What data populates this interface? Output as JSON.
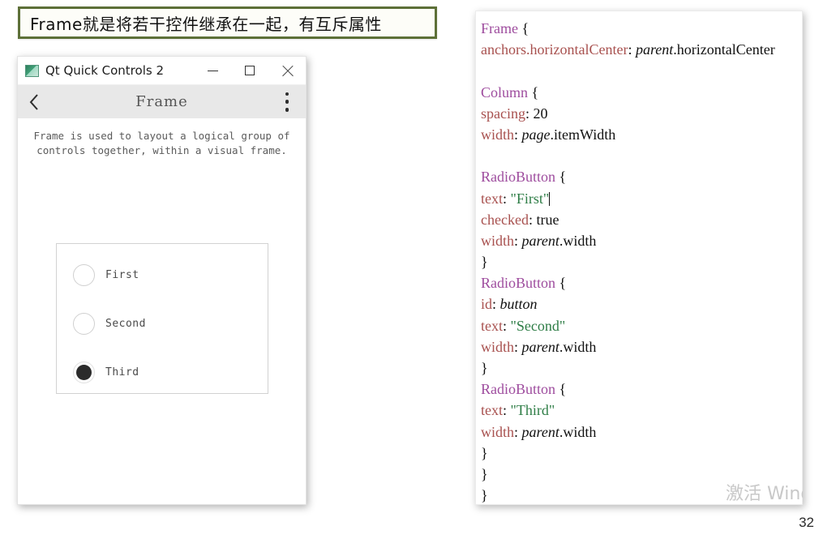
{
  "caption": {
    "text": "Frame就是将若干控件继承在一起，有互斥属性",
    "border_color": "#5d7038"
  },
  "qt_window": {
    "titlebar": {
      "app_icon": "qt-logo-icon",
      "title": "Qt Quick Controls 2",
      "minimize_label": "—",
      "maximize_label": "□",
      "close_label": "✕"
    },
    "toolbar": {
      "back_icon": "chevron-left-icon",
      "title": "Frame",
      "menu_icon": "kebab-menu-icon"
    },
    "description": "Frame is used to layout a logical group of\ncontrols together, within a visual frame.",
    "radio_group": {
      "items": [
        {
          "label": "First",
          "checked": false
        },
        {
          "label": "Second",
          "checked": false
        },
        {
          "label": "Third",
          "checked": true
        }
      ]
    }
  },
  "code_panel": {
    "lines": [
      [
        {
          "t": "type",
          "v": "Frame"
        },
        {
          "t": "plain",
          "v": " {"
        }
      ],
      [
        {
          "t": "prop",
          "v": "anchors.horizontalCenter"
        },
        {
          "t": "plain",
          "v": ": "
        },
        {
          "t": "id",
          "v": "parent"
        },
        {
          "t": "plain",
          "v": ".horizontalCenter"
        }
      ],
      [
        {
          "t": "blank",
          "v": " "
        }
      ],
      [
        {
          "t": "type",
          "v": "Column"
        },
        {
          "t": "plain",
          "v": " {"
        }
      ],
      [
        {
          "t": "prop",
          "v": "spacing"
        },
        {
          "t": "plain",
          "v": ": 20"
        }
      ],
      [
        {
          "t": "prop",
          "v": "width"
        },
        {
          "t": "plain",
          "v": ": "
        },
        {
          "t": "id",
          "v": "page"
        },
        {
          "t": "plain",
          "v": ".itemWidth"
        }
      ],
      [
        {
          "t": "blank",
          "v": " "
        }
      ],
      [
        {
          "t": "type",
          "v": "RadioButton"
        },
        {
          "t": "plain",
          "v": " {"
        }
      ],
      [
        {
          "t": "prop",
          "v": "text"
        },
        {
          "t": "plain",
          "v": ": "
        },
        {
          "t": "str",
          "v": "\"First\""
        },
        {
          "t": "caret",
          "v": ""
        }
      ],
      [
        {
          "t": "prop",
          "v": "checked"
        },
        {
          "t": "plain",
          "v": ": true"
        }
      ],
      [
        {
          "t": "prop",
          "v": "width"
        },
        {
          "t": "plain",
          "v": ": "
        },
        {
          "t": "id",
          "v": "parent"
        },
        {
          "t": "plain",
          "v": ".width"
        }
      ],
      [
        {
          "t": "plain",
          "v": "}"
        }
      ],
      [
        {
          "t": "type",
          "v": "RadioButton"
        },
        {
          "t": "plain",
          "v": " {"
        }
      ],
      [
        {
          "t": "prop",
          "v": "id"
        },
        {
          "t": "plain",
          "v": ": "
        },
        {
          "t": "id",
          "v": "button"
        }
      ],
      [
        {
          "t": "prop",
          "v": "text"
        },
        {
          "t": "plain",
          "v": ": "
        },
        {
          "t": "str",
          "v": "\"Second\""
        }
      ],
      [
        {
          "t": "prop",
          "v": "width"
        },
        {
          "t": "plain",
          "v": ": "
        },
        {
          "t": "id",
          "v": "parent"
        },
        {
          "t": "plain",
          "v": ".width"
        }
      ],
      [
        {
          "t": "plain",
          "v": "}"
        }
      ],
      [
        {
          "t": "type",
          "v": "RadioButton"
        },
        {
          "t": "plain",
          "v": " {"
        }
      ],
      [
        {
          "t": "prop",
          "v": "text"
        },
        {
          "t": "plain",
          "v": ": "
        },
        {
          "t": "str",
          "v": "\"Third\""
        }
      ],
      [
        {
          "t": "prop",
          "v": "width"
        },
        {
          "t": "plain",
          "v": ": "
        },
        {
          "t": "id",
          "v": "parent"
        },
        {
          "t": "plain",
          "v": ".width"
        }
      ],
      [
        {
          "t": "plain",
          "v": "}"
        }
      ],
      [
        {
          "t": "plain",
          "v": "}"
        }
      ],
      [
        {
          "t": "plain",
          "v": "}"
        }
      ]
    ],
    "colors": {
      "type": "#9e4c9e",
      "property": "#a8514f",
      "string": "#2e7d46",
      "identifier": "#111111"
    }
  },
  "watermark": {
    "text": "激活 Windows"
  },
  "page_number": "32"
}
